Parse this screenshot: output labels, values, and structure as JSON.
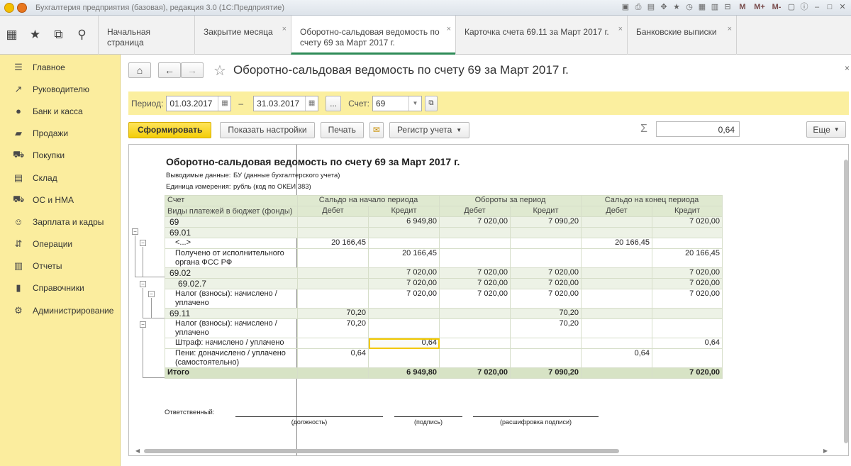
{
  "window": {
    "title": "Бухгалтерия предприятия (базовая), редакция 3.0 (1С:Предприятие)"
  },
  "titlebar_tools": [
    "M",
    "M+",
    "M-"
  ],
  "tabs": [
    {
      "label": "Начальная страница",
      "closable": false
    },
    {
      "label": "Закрытие месяца",
      "closable": true
    },
    {
      "label": "Оборотно-сальдовая ведомость по\nсчету 69 за Март 2017 г.",
      "closable": true,
      "active": true
    },
    {
      "label": "Карточка счета 69.11 за Март 2017 г.",
      "closable": true
    },
    {
      "label": "Банковские выписки",
      "closable": true
    }
  ],
  "sidebar": {
    "items": [
      {
        "label": "Главное",
        "icon": "menu-icon"
      },
      {
        "label": "Руководителю",
        "icon": "trend-icon"
      },
      {
        "label": "Банк и касса",
        "icon": "coin-icon"
      },
      {
        "label": "Продажи",
        "icon": "bag-icon"
      },
      {
        "label": "Покупки",
        "icon": "cart-icon"
      },
      {
        "label": "Склад",
        "icon": "warehouse-icon"
      },
      {
        "label": "ОС и НМА",
        "icon": "truck-icon"
      },
      {
        "label": "Зарплата и кадры",
        "icon": "person-icon"
      },
      {
        "label": "Операции",
        "icon": "operations-icon"
      },
      {
        "label": "Отчеты",
        "icon": "chart-icon"
      },
      {
        "label": "Справочники",
        "icon": "book-icon"
      },
      {
        "label": "Администрирование",
        "icon": "gear-icon"
      }
    ]
  },
  "page": {
    "title": "Оборотно-сальдовая ведомость по счету 69 за Март 2017 г.",
    "close": "×"
  },
  "period": {
    "label": "Период:",
    "from": "01.03.2017",
    "dash": "–",
    "to": "31.03.2017",
    "ellipsis": "...",
    "account_label": "Счет:",
    "account": "69"
  },
  "commands": {
    "generate": "Сформировать",
    "settings": "Показать настройки",
    "print": "Печать",
    "register": "Регистр учета",
    "sum_value": "0,64",
    "more": "Еще"
  },
  "report": {
    "title": "Оборотно-сальдовая ведомость по счету 69 за Март 2017 г.",
    "info": [
      {
        "key": "Выводимые данные:",
        "value": "БУ (данные бухгалтерского учета)"
      },
      {
        "key": "Единица измерения:",
        "value": "рубль (код по ОКЕИ 383)"
      }
    ],
    "headers": {
      "account": "Счет",
      "subconto": "Виды платежей в бюджет (фонды)",
      "opening": "Сальдо на начало периода",
      "turnover": "Обороты за период",
      "closing": "Сальдо на конец периода",
      "debit": "Дебет",
      "credit": "Кредит"
    },
    "rows": [
      {
        "name": "69",
        "kind": "grp",
        "v": [
          "",
          "6 949,80",
          "7 020,00",
          "7 090,20",
          "",
          "7 020,00"
        ]
      },
      {
        "name": "69.01",
        "kind": "grp",
        "v": [
          "",
          "",
          "",
          "",
          "",
          ""
        ]
      },
      {
        "name": "<...>",
        "kind": "item",
        "v": [
          "20 166,45",
          "",
          "",
          "",
          "20 166,45",
          ""
        ]
      },
      {
        "name": "Получено от исполнительного органа ФСС РФ",
        "kind": "item2",
        "v": [
          "",
          "20 166,45",
          "",
          "",
          "",
          "20 166,45"
        ]
      },
      {
        "name": "69.02",
        "kind": "grp",
        "v": [
          "",
          "7 020,00",
          "7 020,00",
          "7 020,00",
          "",
          "7 020,00"
        ]
      },
      {
        "name": "69.02.7",
        "kind": "grp",
        "v": [
          "",
          "7 020,00",
          "7 020,00",
          "7 020,00",
          "",
          "7 020,00"
        ]
      },
      {
        "name": "Налог (взносы): начислено / уплачено",
        "kind": "item2",
        "v": [
          "",
          "7 020,00",
          "7 020,00",
          "7 020,00",
          "",
          "7 020,00"
        ]
      },
      {
        "name": "69.11",
        "kind": "grp",
        "v": [
          "70,20",
          "",
          "",
          "70,20",
          "",
          ""
        ]
      },
      {
        "name": "Налог (взносы): начислено / уплачено",
        "kind": "item2",
        "v": [
          "70,20",
          "",
          "",
          "70,20",
          "",
          ""
        ]
      },
      {
        "name": "Штраф: начислено / уплачено",
        "kind": "item",
        "v": [
          "",
          "0,64",
          "",
          "",
          "",
          "0,64"
        ]
      },
      {
        "name": "Пени: доначислено / уплачено (самостоятельно)",
        "kind": "item2",
        "v": [
          "0,64",
          "",
          "",
          "",
          "0,64",
          ""
        ]
      }
    ],
    "total": {
      "name": "Итого",
      "v": [
        "",
        "6 949,80",
        "7 020,00",
        "7 090,20",
        "",
        "7 020,00"
      ]
    },
    "signature": {
      "label": "Ответственный:",
      "position": "(должность)",
      "sign": "(подпись)",
      "decode": "(расшифровка подписи)"
    }
  }
}
